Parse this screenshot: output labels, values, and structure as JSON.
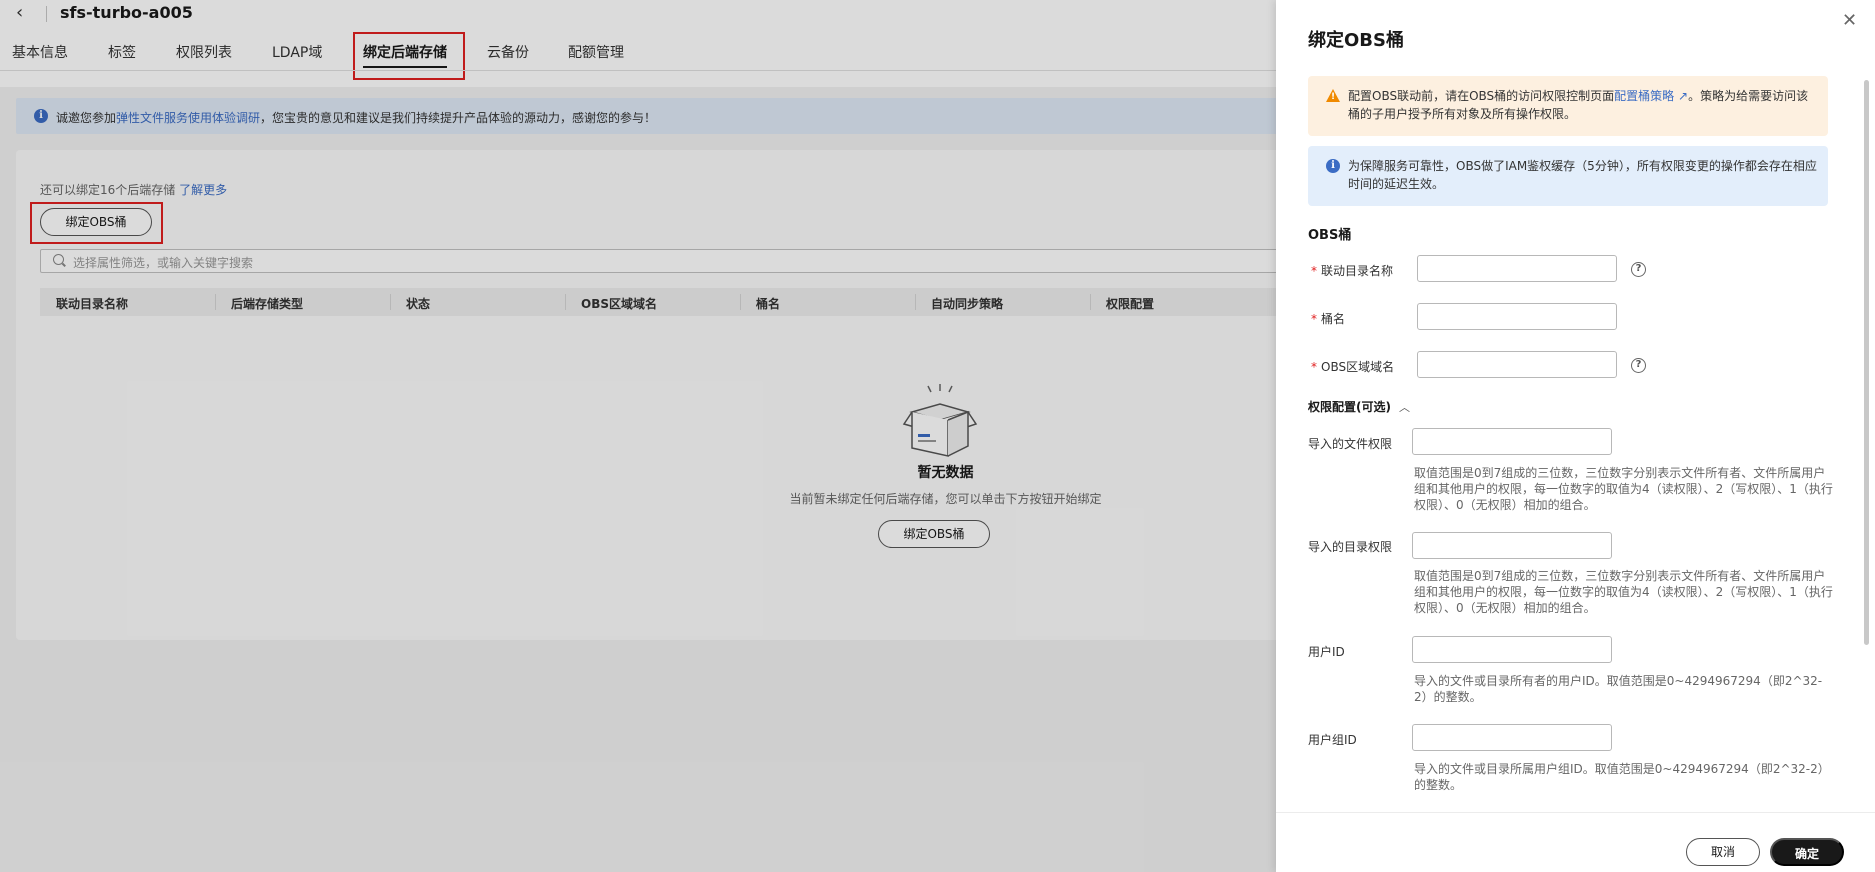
{
  "header": {
    "back_icon": "chevron-left-icon",
    "title": "sfs-turbo-a005"
  },
  "tabs": [
    {
      "label": "基本信息"
    },
    {
      "label": "标签"
    },
    {
      "label": "权限列表"
    },
    {
      "label": "LDAP域"
    },
    {
      "label": "绑定后端存储",
      "active": true
    },
    {
      "label": "云备份"
    },
    {
      "label": "配额管理"
    }
  ],
  "banner": {
    "prefix": "诚邀您参加",
    "link": "弹性文件服务使用体验调研",
    "suffix": "，您宝贵的意见和建议是我们持续提升产品体验的源动力，感谢您的参与！"
  },
  "storage": {
    "hint_prefix": "还可以绑定16个后端存储",
    "hint_link": "了解更多",
    "bind_button": "绑定OBS桶",
    "search_placeholder": "选择属性筛选，或输入关键字搜索",
    "columns": [
      "联动目录名称",
      "后端存储类型",
      "状态",
      "OBS区域域名",
      "桶名",
      "自动同步策略",
      "权限配置"
    ],
    "empty_title": "暂无数据",
    "empty_desc": "当前暂未绑定任何后端存储，您可以单击下方按钮开始绑定",
    "empty_button": "绑定OBS桶"
  },
  "drawer": {
    "title": "绑定OBS桶",
    "close_icon": "close-icon",
    "warning": {
      "prefix": "配置OBS联动前，请在OBS桶的访问权限控制页面",
      "link": "配置桶策略",
      "suffix": "。策略为给需要访问该桶的子用户授予所有对象及所有操作权限。"
    },
    "info": "为保障服务可靠性，OBS做了IAM鉴权缓存（5分钟），所有权限变更的操作都会存在相应时间的延迟生效。",
    "section_title": "OBS桶",
    "fields": {
      "dir_name": {
        "label": "联动目录名称",
        "value": ""
      },
      "bucket": {
        "label": "桶名",
        "value": ""
      },
      "domain": {
        "label": "OBS区域域名",
        "value": ""
      }
    },
    "permission_title": "权限配置(可选)",
    "perm": {
      "file_perm": {
        "label": "导入的文件权限",
        "value": "",
        "help": "取值范围是0到7组成的三位数，三位数字分别表示文件所有者、文件所属用户组和其他用户的权限，每一位数字的取值为4（读权限）、2（写权限）、1（执行权限）、0（无权限）相加的组合。"
      },
      "dir_perm": {
        "label": "导入的目录权限",
        "value": "",
        "help": "取值范围是0到7组成的三位数，三位数字分别表示文件所有者、文件所属用户组和其他用户的权限，每一位数字的取值为4（读权限）、2（写权限）、1（执行权限）、0（无权限）相加的组合。"
      },
      "user_id": {
        "label": "用户ID",
        "value": "",
        "help": "导入的文件或目录所有者的用户ID。取值范围是0~4294967294（即2^32-2）的整数。"
      },
      "group_id": {
        "label": "用户组ID",
        "value": "",
        "help": "导入的文件或目录所属用户组ID。取值范围是0~4294967294（即2^32-2）的整数。"
      }
    },
    "cancel": "取消",
    "ok": "确定"
  },
  "colors": {
    "accent": "#3b6cc4",
    "highlight": "#e02020",
    "warning": "#f08a00",
    "primary_button": "#191919"
  }
}
